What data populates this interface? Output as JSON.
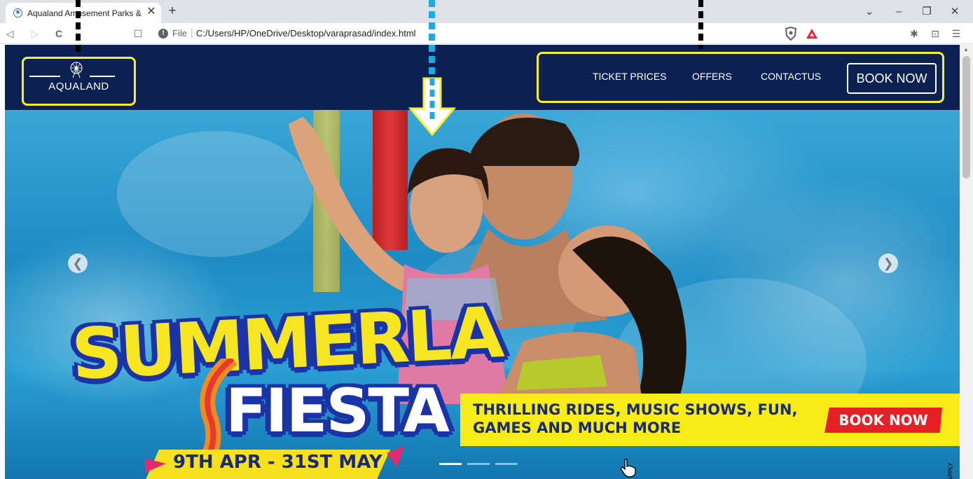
{
  "browser": {
    "tab_title": "Aqualand Amusement Parks & Re",
    "new_tab_glyph": "+",
    "close_glyph": "✕",
    "window_buttons": [
      "⌄",
      "–",
      "❐",
      "✕"
    ],
    "nav_glyphs": [
      "◁",
      "▷",
      "C",
      "☐"
    ],
    "address_scheme": "File",
    "address_separator": "|",
    "address_url": "C:/Users/HP/OneDrive/Desktop/varaprasad/index.html",
    "info_glyph": "!",
    "right_icons": [
      "extensions-icon",
      "wallet-icon",
      "menu-icon"
    ],
    "right_glyphs": [
      "✱",
      "⊡",
      "☰"
    ]
  },
  "site": {
    "brand": "AQUALAND",
    "nav_links": [
      "TICKET PRICES",
      "OFFERS",
      "CONTACTUS"
    ],
    "book_button": "BOOK NOW",
    "accent_color": "#f7ee32",
    "nav_bg": "#0c2152"
  },
  "hero": {
    "headline_top": "SUMMERLA",
    "headline_bottom": "FIESTA",
    "banner_text": "THRILLING RIDES, MUSIC SHOWS, FUN, GAMES AND MUCH MORE",
    "banner_button": "BOOK NOW",
    "dates": "9TH APR - 31ST MAY",
    "prev_glyph": "❮",
    "next_glyph": "❯",
    "fine_print": "APPLY"
  }
}
